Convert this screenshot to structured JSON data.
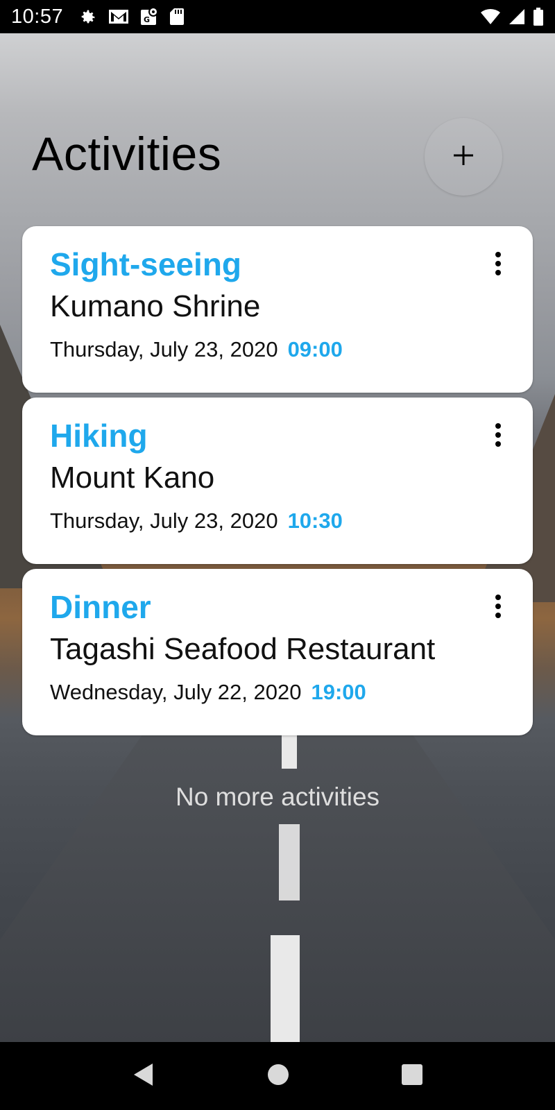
{
  "status_bar": {
    "time": "10:57",
    "left_icons": [
      "gear-icon",
      "gmail-icon",
      "maps-icon",
      "sd-card-icon"
    ],
    "right_icons": [
      "wifi-icon",
      "signal-icon",
      "battery-icon"
    ]
  },
  "header": {
    "title": "Activities",
    "add_label": "+"
  },
  "activities": [
    {
      "type": "Sight-seeing",
      "place": "Kumano Shrine",
      "date": "Thursday, July 23, 2020",
      "time": "09:00"
    },
    {
      "type": "Hiking",
      "place": "Mount Kano",
      "date": "Thursday, July 23, 2020",
      "time": "10:30"
    },
    {
      "type": "Dinner",
      "place": "Tagashi Seafood Restaurant",
      "date": "Wednesday, July 22, 2020",
      "time": "19:00"
    }
  ],
  "list_end_text": "No more activities",
  "colors": {
    "accent": "#1fa8ec",
    "card_background": "#ffffff",
    "system_bar": "#000000"
  },
  "nav_bar": {
    "buttons": [
      "back-icon",
      "home-icon",
      "recents-icon"
    ]
  }
}
